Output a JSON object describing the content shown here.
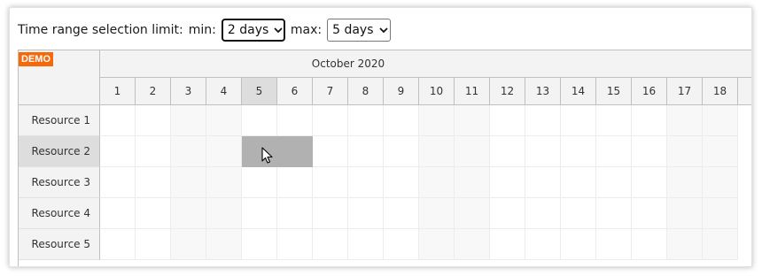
{
  "toolbar": {
    "label": "Time range selection limit:",
    "min_label": "min:",
    "min_value": "2 days",
    "max_label": "max:",
    "max_value": "5 days"
  },
  "scheduler": {
    "demo_badge": "DEMO",
    "month": "October 2020",
    "days": [
      "1",
      "2",
      "3",
      "4",
      "5",
      "6",
      "7",
      "8",
      "9",
      "10",
      "11",
      "12",
      "13",
      "14",
      "15",
      "16",
      "17",
      "18"
    ],
    "weekend_days": [
      "3",
      "4",
      "10",
      "11",
      "17",
      "18"
    ],
    "active_day": "5",
    "resources": [
      "Resource 1",
      "Resource 2",
      "Resource 3",
      "Resource 4",
      "Resource 5"
    ],
    "active_resource": "Resource 2",
    "selection": {
      "resource": "Resource 2",
      "start_day": "5",
      "end_day": "6"
    },
    "colors": {
      "demo_badge": "#f5690b",
      "header_bg": "#f3f3f3",
      "active_header": "#dddddd",
      "selection": "#b1b1b1"
    },
    "cursor": "arrow-cursor-icon"
  }
}
